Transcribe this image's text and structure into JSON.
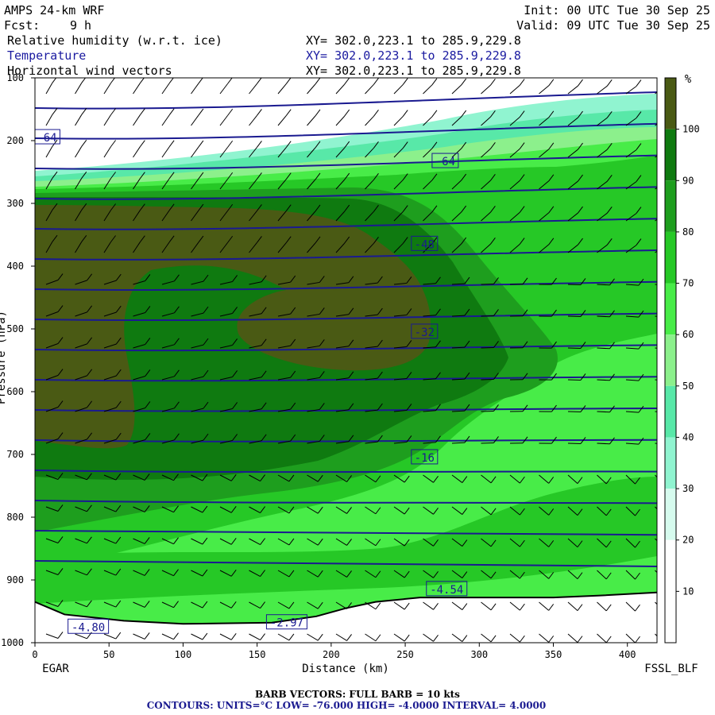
{
  "header": {
    "model": "AMPS 24-km WRF",
    "init": "Init: 00 UTC Tue 30 Sep 25",
    "fcst_label": "Fcst:",
    "fcst_value": "9 h",
    "valid": "Valid: 09 UTC Tue 30 Sep 25",
    "fields": [
      {
        "name": "Relative humidity (w.r.t. ice)",
        "xy": "XY= 302.0,223.1 to 285.9,229.8",
        "color": "#000000"
      },
      {
        "name": "Temperature",
        "xy": "XY= 302.0,223.1 to 285.9,229.8",
        "color": "#1a1aa0"
      },
      {
        "name": "Horizontal wind vectors",
        "xy": "XY= 302.0,223.1 to 285.9,229.8",
        "color": "#000000"
      }
    ]
  },
  "stations": {
    "left": "EGAR",
    "right": "FSSL_BLF"
  },
  "footer": {
    "line1": "BARB VECTORS:  FULL BARB = 10 kts",
    "line2": "CONTOURS:  UNITS=°C  LOW= -76.000        HIGH= -4.0000      INTERVAL=    4.0000"
  },
  "colorbar": {
    "unit": "%",
    "ticks": [
      "100",
      "90",
      "80",
      "70",
      "60",
      "50",
      "40",
      "30",
      "20",
      "10"
    ],
    "colors": [
      "#4a5a14",
      "#0f7a10",
      "#1e9e1e",
      "#26c826",
      "#48ec48",
      "#8cf08c",
      "#58e8a8",
      "#90f4d0",
      "#d6fbee",
      "#ffffff",
      "#ffffff"
    ]
  },
  "chart_data": {
    "type": "heatmap",
    "title": "Relative humidity (w.r.t. ice), Temperature, Horizontal wind vectors",
    "xlabel": "Distance (km)",
    "ylabel": "Pressure (hPa)",
    "xlim": [
      0,
      420
    ],
    "ylim": [
      1000,
      100
    ],
    "x_ticks": [
      0,
      50,
      100,
      150,
      200,
      250,
      300,
      350,
      400
    ],
    "y_ticks": [
      100,
      200,
      300,
      400,
      500,
      600,
      700,
      800,
      900,
      1000
    ],
    "temperature_contour_labels": [
      {
        "label": "-64",
        "x": 8,
        "p": 195
      },
      {
        "label": "-64",
        "x": 277,
        "p": 233
      },
      {
        "label": "-48",
        "x": 263,
        "p": 365
      },
      {
        "label": "-32",
        "x": 263,
        "p": 505
      },
      {
        "label": "-16",
        "x": 263,
        "p": 705
      },
      {
        "label": "-4.54",
        "x": 278,
        "p": 915
      },
      {
        "label": "-4.80",
        "x": 36,
        "p": 975
      },
      {
        "label": "-2.97",
        "x": 170,
        "p": 968
      }
    ],
    "terrain_surface": [
      {
        "x": 0,
        "p": 935
      },
      {
        "x": 20,
        "p": 955
      },
      {
        "x": 60,
        "p": 965
      },
      {
        "x": 100,
        "p": 970
      },
      {
        "x": 160,
        "p": 968
      },
      {
        "x": 190,
        "p": 958
      },
      {
        "x": 210,
        "p": 945
      },
      {
        "x": 230,
        "p": 935
      },
      {
        "x": 260,
        "p": 928
      },
      {
        "x": 300,
        "p": 928
      },
      {
        "x": 350,
        "p": 928
      },
      {
        "x": 380,
        "p": 925
      },
      {
        "x": 420,
        "p": 920
      }
    ]
  }
}
